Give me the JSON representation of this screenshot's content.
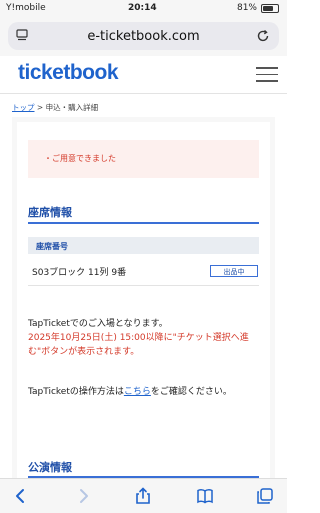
{
  "status_bar": {
    "carrier": "Y!mobile",
    "time": "20:14",
    "battery": "81%",
    "battery_level": 0.81
  },
  "browser": {
    "url": "e-ticketbook.com"
  },
  "site": {
    "logo": "ticketbook"
  },
  "breadcrumb": {
    "home": "トップ",
    "separator": ">",
    "current": "申込・購入詳細"
  },
  "alert": {
    "message": "・ご用意できました"
  },
  "seat_section": {
    "title": "座席情報",
    "header": "座席番号",
    "seat": "S03ブロック 11列 9番",
    "status_badge": "出品中"
  },
  "notice": {
    "line1": "TapTicketでのご入場となります。",
    "line2": "2025年10月25日(土) 15:00以降に\"チケット選択へ進む\"ボタンが表示されます。",
    "line3_before": "TapTicketの操作方法は",
    "line3_link": "こちら",
    "line3_after": "をご確認ください。"
  },
  "performance_section": {
    "title": "公演情報"
  },
  "colors": {
    "brand": "#1f63cc",
    "alert_text": "#d43a2a",
    "section_title": "#1f4fa8"
  },
  "toolbar_icons": [
    "back-icon",
    "forward-icon",
    "share-icon",
    "bookmarks-icon",
    "tabs-icon"
  ]
}
